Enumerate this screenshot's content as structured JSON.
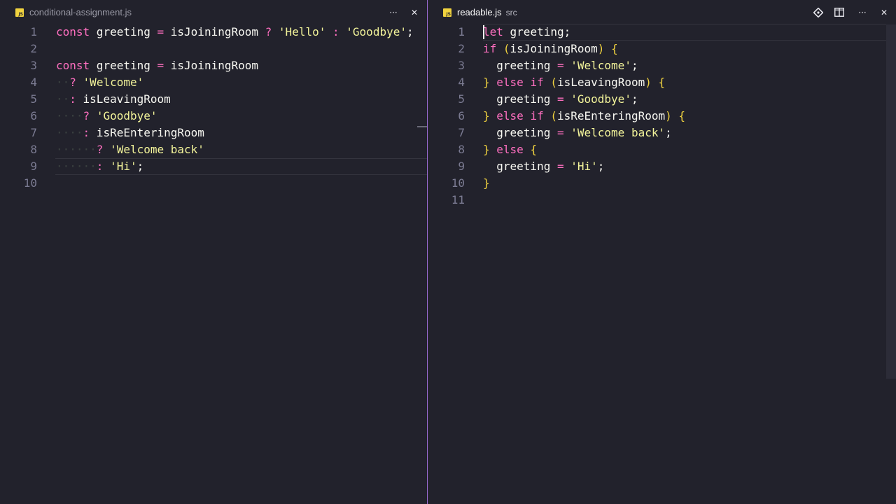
{
  "left_editor": {
    "tab": {
      "icon": "js-file-icon",
      "icon_text": "JS",
      "title": "conditional-assignment.js"
    },
    "actions": {
      "more_icon": "more-actions-icon",
      "more_label": "···",
      "close_icon": "close-icon",
      "close_label": "✕"
    },
    "line_numbers": [
      "1",
      "2",
      "3",
      "4",
      "5",
      "6",
      "7",
      "8",
      "9",
      "10"
    ],
    "lines": [
      [
        {
          "t": "const",
          "c": "k"
        },
        {
          "t": " greeting ",
          "c": "v"
        },
        {
          "t": "=",
          "c": "o"
        },
        {
          "t": " isJoiningRoom ",
          "c": "v"
        },
        {
          "t": "?",
          "c": "o"
        },
        {
          "t": " ",
          "c": "v"
        },
        {
          "t": "'Hello'",
          "c": "s"
        },
        {
          "t": " ",
          "c": "v"
        },
        {
          "t": ":",
          "c": "o"
        },
        {
          "t": " ",
          "c": "v"
        },
        {
          "t": "'Goodbye'",
          "c": "s"
        },
        {
          "t": ";",
          "c": "p"
        }
      ],
      [],
      [
        {
          "t": "const",
          "c": "k"
        },
        {
          "t": " greeting ",
          "c": "v"
        },
        {
          "t": "=",
          "c": "o"
        },
        {
          "t": " isJoiningRoom",
          "c": "v"
        }
      ],
      [
        {
          "t": "··",
          "c": "ws"
        },
        {
          "t": "?",
          "c": "o"
        },
        {
          "t": " ",
          "c": "v"
        },
        {
          "t": "'Welcome'",
          "c": "s"
        }
      ],
      [
        {
          "t": "··",
          "c": "ws"
        },
        {
          "t": ":",
          "c": "o"
        },
        {
          "t": " isLeavingRoom",
          "c": "v"
        }
      ],
      [
        {
          "t": "····",
          "c": "ws"
        },
        {
          "t": "?",
          "c": "o"
        },
        {
          "t": " ",
          "c": "v"
        },
        {
          "t": "'Goodbye'",
          "c": "s"
        }
      ],
      [
        {
          "t": "····",
          "c": "ws"
        },
        {
          "t": ":",
          "c": "o"
        },
        {
          "t": " isReEnteringRoom",
          "c": "v"
        }
      ],
      [
        {
          "t": "······",
          "c": "ws"
        },
        {
          "t": "?",
          "c": "o"
        },
        {
          "t": " ",
          "c": "v"
        },
        {
          "t": "'Welcome back'",
          "c": "s"
        }
      ],
      [
        {
          "t": "······",
          "c": "ws"
        },
        {
          "t": ":",
          "c": "o"
        },
        {
          "t": " ",
          "c": "v"
        },
        {
          "t": "'Hi'",
          "c": "s"
        },
        {
          "t": ";",
          "c": "p"
        }
      ],
      []
    ]
  },
  "right_editor": {
    "tab": {
      "icon": "js-file-icon",
      "icon_text": "JS",
      "title": "readable.js",
      "description": "src"
    },
    "actions": {
      "git_icon": "git-compare-icon",
      "git_label": "◈",
      "split_icon": "split-editor-icon",
      "split_label": "◫",
      "more_icon": "more-actions-icon",
      "more_label": "···",
      "close_icon": "close-icon",
      "close_label": "✕"
    },
    "line_numbers": [
      "1",
      "2",
      "3",
      "4",
      "5",
      "6",
      "7",
      "8",
      "9",
      "10",
      "11"
    ],
    "lines": [
      [
        {
          "t": "let",
          "c": "k"
        },
        {
          "t": " greeting;",
          "c": "v"
        }
      ],
      [
        {
          "t": "if",
          "c": "k"
        },
        {
          "t": " ",
          "c": "v"
        },
        {
          "t": "(",
          "c": "b"
        },
        {
          "t": "isJoiningRoom",
          "c": "v"
        },
        {
          "t": ")",
          "c": "b"
        },
        {
          "t": " ",
          "c": "v"
        },
        {
          "t": "{",
          "c": "b"
        }
      ],
      [
        {
          "t": "  greeting ",
          "c": "v"
        },
        {
          "t": "=",
          "c": "o"
        },
        {
          "t": " ",
          "c": "v"
        },
        {
          "t": "'Welcome'",
          "c": "s"
        },
        {
          "t": ";",
          "c": "p"
        }
      ],
      [
        {
          "t": "}",
          "c": "b"
        },
        {
          "t": " ",
          "c": "v"
        },
        {
          "t": "else",
          "c": "k"
        },
        {
          "t": " ",
          "c": "v"
        },
        {
          "t": "if",
          "c": "k"
        },
        {
          "t": " ",
          "c": "v"
        },
        {
          "t": "(",
          "c": "b"
        },
        {
          "t": "isLeavingRoom",
          "c": "v"
        },
        {
          "t": ")",
          "c": "b"
        },
        {
          "t": " ",
          "c": "v"
        },
        {
          "t": "{",
          "c": "b"
        }
      ],
      [
        {
          "t": "  greeting ",
          "c": "v"
        },
        {
          "t": "=",
          "c": "o"
        },
        {
          "t": " ",
          "c": "v"
        },
        {
          "t": "'Goodbye'",
          "c": "s"
        },
        {
          "t": ";",
          "c": "p"
        }
      ],
      [
        {
          "t": "}",
          "c": "b"
        },
        {
          "t": " ",
          "c": "v"
        },
        {
          "t": "else",
          "c": "k"
        },
        {
          "t": " ",
          "c": "v"
        },
        {
          "t": "if",
          "c": "k"
        },
        {
          "t": " ",
          "c": "v"
        },
        {
          "t": "(",
          "c": "b"
        },
        {
          "t": "isReEnteringRoom",
          "c": "v"
        },
        {
          "t": ")",
          "c": "b"
        },
        {
          "t": " ",
          "c": "v"
        },
        {
          "t": "{",
          "c": "b"
        }
      ],
      [
        {
          "t": "  greeting ",
          "c": "v"
        },
        {
          "t": "=",
          "c": "o"
        },
        {
          "t": " ",
          "c": "v"
        },
        {
          "t": "'Welcome back'",
          "c": "s"
        },
        {
          "t": ";",
          "c": "p"
        }
      ],
      [
        {
          "t": "}",
          "c": "b"
        },
        {
          "t": " ",
          "c": "v"
        },
        {
          "t": "else",
          "c": "k"
        },
        {
          "t": " ",
          "c": "v"
        },
        {
          "t": "{",
          "c": "b"
        }
      ],
      [
        {
          "t": "  greeting ",
          "c": "v"
        },
        {
          "t": "=",
          "c": "o"
        },
        {
          "t": " ",
          "c": "v"
        },
        {
          "t": "'Hi'",
          "c": "s"
        },
        {
          "t": ";",
          "c": "p"
        }
      ],
      [
        {
          "t": "}",
          "c": "b"
        }
      ],
      []
    ]
  },
  "colors": {
    "background": "#22222c",
    "keyword": "#ff6fc0",
    "string": "#f3f49a",
    "bracket": "#f1d33f",
    "line_number": "#7b7b92",
    "divider": "#9b6bd4"
  }
}
